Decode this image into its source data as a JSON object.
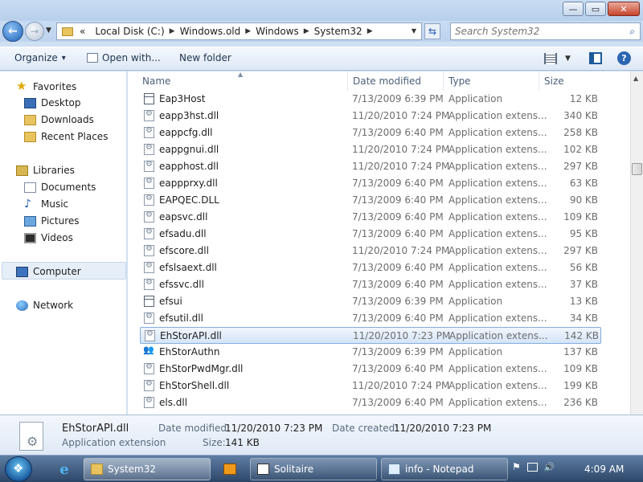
{
  "window": {
    "min_icon": "minimize-icon",
    "max_icon": "maximize-icon",
    "close_icon": "close-icon",
    "min_glyph": "—",
    "max_glyph": "▭",
    "close_glyph": "✕"
  },
  "address": {
    "back_glyph": "←",
    "forward_glyph": "→",
    "prefix": "«",
    "crumbs": [
      "Local Disk (C:)",
      "Windows.old",
      "Windows",
      "System32"
    ],
    "refresh_glyph": "⇆"
  },
  "search": {
    "placeholder": "Search System32",
    "icon": "search-icon"
  },
  "toolbar": {
    "organize_label": "Organize",
    "organize_arrow": "▾",
    "open_with_label": "Open with...",
    "new_folder_label": "New folder",
    "help_glyph": "?"
  },
  "nav": {
    "favorites": "Favorites",
    "desktop": "Desktop",
    "downloads": "Downloads",
    "recent_places": "Recent Places",
    "libraries": "Libraries",
    "documents": "Documents",
    "music": "Music",
    "pictures": "Pictures",
    "videos": "Videos",
    "computer": "Computer",
    "network": "Network"
  },
  "columns": {
    "name": "Name",
    "date": "Date modified",
    "type": "Type",
    "size": "Size"
  },
  "files": [
    {
      "name": "Eap3Host",
      "date": "7/13/2009 6:39 PM",
      "type": "Application",
      "size": "12 KB",
      "icon": "app"
    },
    {
      "name": "eapp3hst.dll",
      "date": "11/20/2010 7:24 PM",
      "type": "Application extens...",
      "size": "340 KB",
      "icon": "dll"
    },
    {
      "name": "eappcfg.dll",
      "date": "7/13/2009 6:40 PM",
      "type": "Application extens...",
      "size": "258 KB",
      "icon": "dll"
    },
    {
      "name": "eappgnui.dll",
      "date": "11/20/2010 7:24 PM",
      "type": "Application extens...",
      "size": "102 KB",
      "icon": "dll"
    },
    {
      "name": "eapphost.dll",
      "date": "11/20/2010 7:24 PM",
      "type": "Application extens...",
      "size": "297 KB",
      "icon": "dll"
    },
    {
      "name": "eappprxy.dll",
      "date": "7/13/2009 6:40 PM",
      "type": "Application extens...",
      "size": "63 KB",
      "icon": "dll"
    },
    {
      "name": "EAPQEC.DLL",
      "date": "7/13/2009 6:40 PM",
      "type": "Application extens...",
      "size": "90 KB",
      "icon": "dll"
    },
    {
      "name": "eapsvc.dll",
      "date": "7/13/2009 6:40 PM",
      "type": "Application extens...",
      "size": "109 KB",
      "icon": "dll"
    },
    {
      "name": "efsadu.dll",
      "date": "7/13/2009 6:40 PM",
      "type": "Application extens...",
      "size": "95 KB",
      "icon": "dll"
    },
    {
      "name": "efscore.dll",
      "date": "11/20/2010 7:24 PM",
      "type": "Application extens...",
      "size": "297 KB",
      "icon": "dll"
    },
    {
      "name": "efslsaext.dll",
      "date": "7/13/2009 6:40 PM",
      "type": "Application extens...",
      "size": "56 KB",
      "icon": "dll"
    },
    {
      "name": "efssvc.dll",
      "date": "7/13/2009 6:40 PM",
      "type": "Application extens...",
      "size": "37 KB",
      "icon": "dll"
    },
    {
      "name": "efsui",
      "date": "7/13/2009 6:39 PM",
      "type": "Application",
      "size": "13 KB",
      "icon": "app"
    },
    {
      "name": "efsutil.dll",
      "date": "7/13/2009 6:40 PM",
      "type": "Application extens...",
      "size": "34 KB",
      "icon": "dll"
    },
    {
      "name": "EhStorAPI.dll",
      "date": "11/20/2010 7:23 PM",
      "type": "Application extens...",
      "size": "142 KB",
      "icon": "dll",
      "selected": true
    },
    {
      "name": "EhStorAuthn",
      "date": "7/13/2009 6:39 PM",
      "type": "Application",
      "size": "137 KB",
      "icon": "people"
    },
    {
      "name": "EhStorPwdMgr.dll",
      "date": "7/13/2009 6:40 PM",
      "type": "Application extens...",
      "size": "109 KB",
      "icon": "dll"
    },
    {
      "name": "EhStorShell.dll",
      "date": "11/20/2010 7:24 PM",
      "type": "Application extens...",
      "size": "199 KB",
      "icon": "dll"
    },
    {
      "name": "els.dll",
      "date": "7/13/2009 6:40 PM",
      "type": "Application extens...",
      "size": "236 KB",
      "icon": "dll"
    }
  ],
  "details": {
    "name": "EhStorAPI.dll",
    "kind": "Application extension",
    "modified_label": "Date modified:",
    "modified_value": "11/20/2010 7:23 PM",
    "created_label": "Date created:",
    "created_value": "11/20/2010 7:23 PM",
    "size_label": "Size:",
    "size_value": "141 KB"
  },
  "taskbar": {
    "explorer_label": "System32",
    "solitaire_label": "Solitaire",
    "notepad_label": "info - Notepad",
    "ie_glyph": "e",
    "clock": "4:09 AM",
    "flag_glyph": "⚑",
    "volume_glyph": "🔊"
  }
}
